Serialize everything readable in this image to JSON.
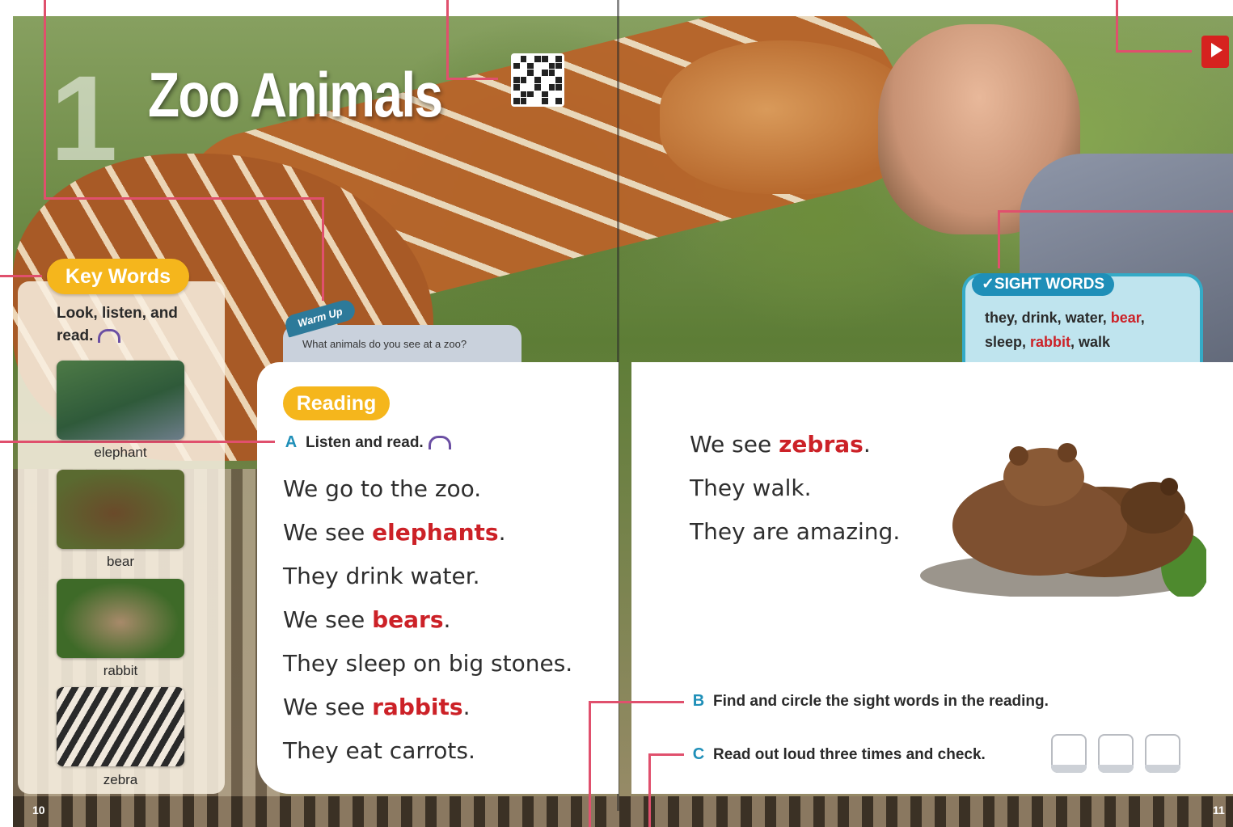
{
  "title": {
    "unit_number": "1",
    "text": "Zoo Animals"
  },
  "key_words": {
    "heading": "Key Words",
    "instruction": "Look, listen, and read.",
    "items": [
      {
        "label": "elephant"
      },
      {
        "label": "bear"
      },
      {
        "label": "rabbit"
      },
      {
        "label": "zebra"
      }
    ]
  },
  "warm_up": {
    "tag": "Warm Up",
    "question": "What animals do you see at a zoo?"
  },
  "reading": {
    "heading": "Reading",
    "step_a": {
      "letter": "A",
      "text": "Listen and read."
    },
    "left_lines": [
      {
        "pre": "We go to the zoo.",
        "hl": "",
        "post": ""
      },
      {
        "pre": "We see ",
        "hl": "elephants",
        "post": "."
      },
      {
        "pre": "They drink water.",
        "hl": "",
        "post": ""
      },
      {
        "pre": "We see ",
        "hl": "bears",
        "post": "."
      },
      {
        "pre": "They sleep on big stones.",
        "hl": "",
        "post": ""
      },
      {
        "pre": "We see ",
        "hl": "rabbits",
        "post": "."
      },
      {
        "pre": "They eat carrots.",
        "hl": "",
        "post": ""
      }
    ],
    "right_lines": [
      {
        "pre": "We see ",
        "hl": "zebras",
        "post": "."
      },
      {
        "pre": "They walk.",
        "hl": "",
        "post": ""
      },
      {
        "pre": "They are amazing.",
        "hl": "",
        "post": ""
      }
    ],
    "step_b": {
      "letter": "B",
      "text": "Find and circle the sight words in the reading."
    },
    "step_c": {
      "letter": "C",
      "text": "Read out loud three times and check."
    }
  },
  "sight_words": {
    "heading": "✓SIGHT WORDS",
    "line1_parts": [
      "they, drink, water, ",
      "bear",
      ","
    ],
    "line2_parts": [
      "sleep, ",
      "rabbit",
      ", walk"
    ]
  },
  "page_numbers": {
    "left": "10",
    "right": "11"
  },
  "colors": {
    "accent_yellow": "#f5b61c",
    "highlight_red": "#cc2127",
    "teal": "#1f8fb8",
    "callout_pink": "#e0506d"
  }
}
